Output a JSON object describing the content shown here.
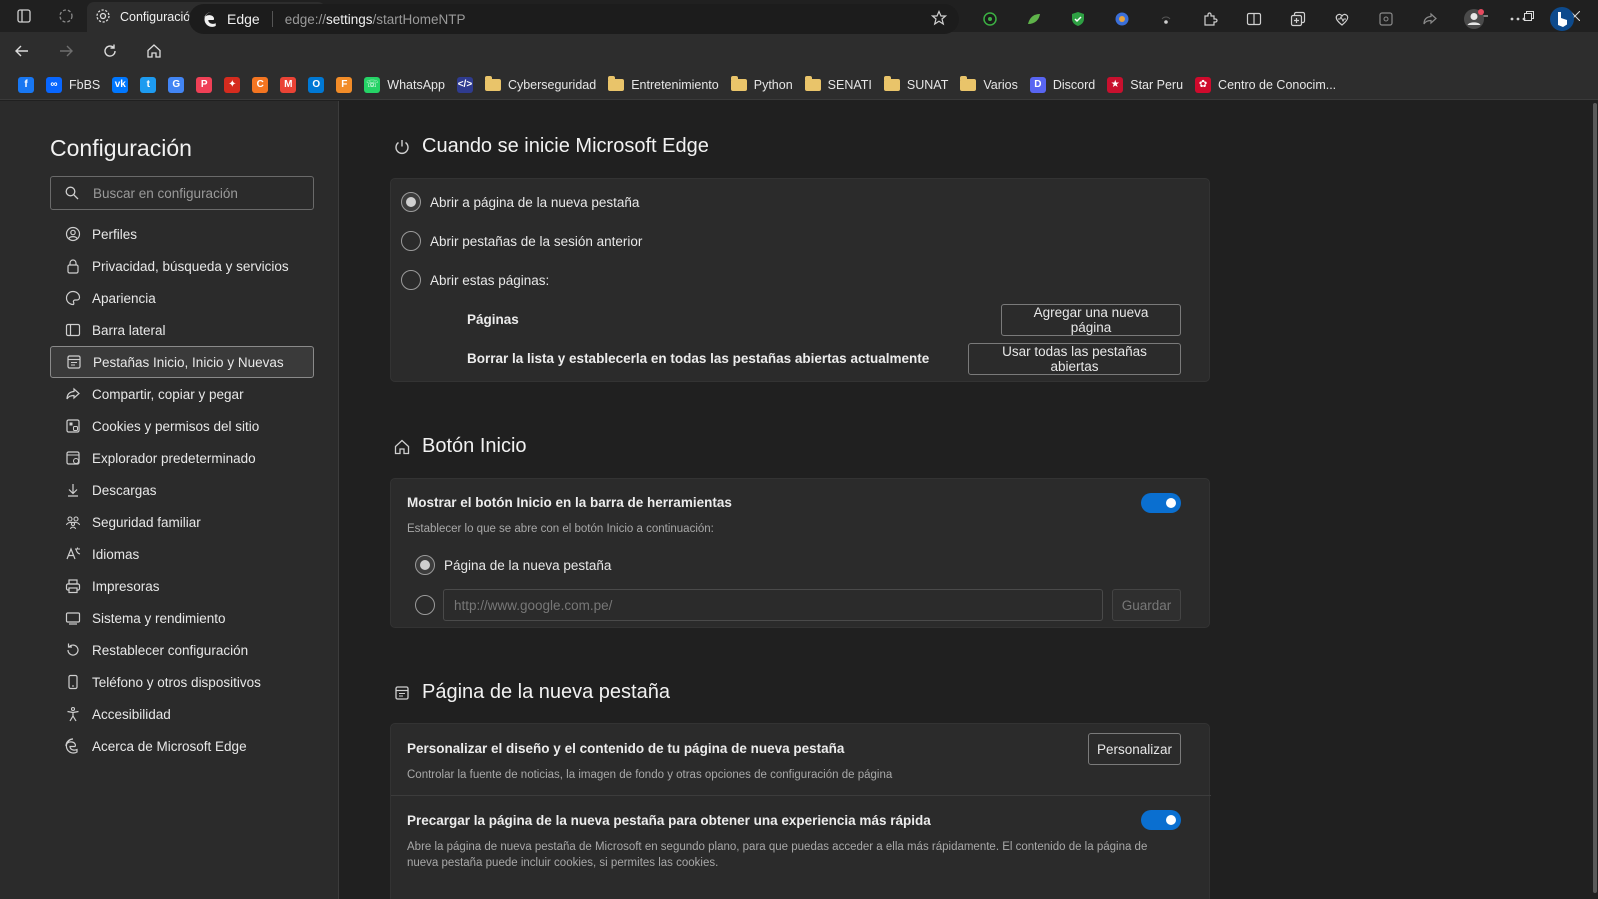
{
  "window": {
    "tab_title": "Configuración",
    "new_tab": "+"
  },
  "toolbar": {
    "brand": "Edge",
    "url_prefix": "edge://",
    "url_bold": "settings",
    "url_rest": "/startHomeNTP"
  },
  "favorites": [
    {
      "label": "",
      "icon": "facebook-icon",
      "color": "#1877f2",
      "glyph": "f"
    },
    {
      "label": "FbBS",
      "icon": "meta-icon",
      "color": "#0866ff",
      "glyph": "∞"
    },
    {
      "label": "",
      "icon": "vk-icon",
      "color": "#0077ff",
      "glyph": "vk"
    },
    {
      "label": "",
      "icon": "twitter-icon",
      "color": "#1d9bf0",
      "glyph": "t"
    },
    {
      "label": "",
      "icon": "translate-icon",
      "color": "#4285f4",
      "glyph": "G"
    },
    {
      "label": "",
      "icon": "pocket-icon",
      "color": "#ef4056",
      "glyph": "P"
    },
    {
      "label": "",
      "icon": "canada-icon",
      "color": "#d52b1e",
      "glyph": "✦"
    },
    {
      "label": "",
      "icon": "crunchyroll-icon",
      "color": "#f47521",
      "glyph": "C"
    },
    {
      "label": "",
      "icon": "gmail-icon",
      "color": "#ea4335",
      "glyph": "M"
    },
    {
      "label": "",
      "icon": "outlook-icon",
      "color": "#0078d4",
      "glyph": "O"
    },
    {
      "label": "",
      "icon": "fiverr-icon",
      "color": "#f28c28",
      "glyph": "F"
    },
    {
      "label": "WhatsApp",
      "icon": "whatsapp-icon",
      "color": "#25d366",
      "glyph": "☏"
    },
    {
      "label": "",
      "icon": "code-icon",
      "color": "#2f3b8f",
      "glyph": "</>"
    },
    {
      "label": "Cyberseguridad",
      "icon": "folder-icon"
    },
    {
      "label": "Entretenimiento",
      "icon": "folder-icon"
    },
    {
      "label": "Python",
      "icon": "folder-icon"
    },
    {
      "label": "SENATI",
      "icon": "folder-icon"
    },
    {
      "label": "SUNAT",
      "icon": "folder-icon"
    },
    {
      "label": "Varios",
      "icon": "folder-icon"
    },
    {
      "label": "Discord",
      "icon": "discord-icon",
      "color": "#5865f2",
      "glyph": "D"
    },
    {
      "label": "Star Peru",
      "icon": "starperu-icon",
      "color": "#c8102e",
      "glyph": "★"
    },
    {
      "label": "Centro de Conocim...",
      "icon": "huawei-icon",
      "color": "#cf0a2c",
      "glyph": "✿"
    }
  ],
  "sidebar": {
    "title": "Configuración",
    "search_placeholder": "Buscar en configuración",
    "items": [
      {
        "label": "Perfiles",
        "icon": "profile-icon"
      },
      {
        "label": "Privacidad, búsqueda y servicios",
        "icon": "lock-icon"
      },
      {
        "label": "Apariencia",
        "icon": "appearance-icon"
      },
      {
        "label": "Barra lateral",
        "icon": "sidebar-icon"
      },
      {
        "label": "Pestañas Inicio, Inicio y Nuevas",
        "icon": "start-tabs-icon",
        "active": true
      },
      {
        "label": "Compartir, copiar y pegar",
        "icon": "share-icon"
      },
      {
        "label": "Cookies y permisos del sitio",
        "icon": "cookies-icon"
      },
      {
        "label": "Explorador predeterminado",
        "icon": "default-browser-icon"
      },
      {
        "label": "Descargas",
        "icon": "download-icon"
      },
      {
        "label": "Seguridad familiar",
        "icon": "family-icon"
      },
      {
        "label": "Idiomas",
        "icon": "languages-icon"
      },
      {
        "label": "Impresoras",
        "icon": "printer-icon"
      },
      {
        "label": "Sistema y rendimiento",
        "icon": "system-icon"
      },
      {
        "label": "Restablecer configuración",
        "icon": "reset-icon"
      },
      {
        "label": "Teléfono y otros dispositivos",
        "icon": "phone-icon"
      },
      {
        "label": "Accesibilidad",
        "icon": "accessibility-icon"
      },
      {
        "label": "Acerca de Microsoft Edge",
        "icon": "edge-icon"
      }
    ]
  },
  "startup": {
    "title": "Cuando se inicie Microsoft Edge",
    "option_ntp": "Abrir a página de la nueva pestaña",
    "option_previous": "Abrir pestañas de la sesión anterior",
    "option_pages": "Abrir estas páginas:",
    "pages_label": "Páginas",
    "add_page_button": "Agregar una nueva página",
    "clear_label": "Borrar la lista y establecerla en todas las pestañas abiertas actualmente",
    "use_all_button": "Usar todas las pestañas abiertas",
    "selected": "ntp"
  },
  "home_button": {
    "title": "Botón Inicio",
    "show_label": "Mostrar el botón Inicio en la barra de herramientas",
    "show_enabled": true,
    "desc": "Establecer lo que se abre con el botón Inicio a continuación:",
    "option_ntp": "Página de la nueva pestaña",
    "url_placeholder": "http://www.google.com.pe/",
    "save_button": "Guardar"
  },
  "new_tab_page": {
    "title": "Página de la nueva pestaña",
    "customize_label": "Personalizar el diseño y el contenido de tu página de nueva pestaña",
    "customize_desc": "Controlar la fuente de noticias, la imagen de fondo y otras opciones de configuración de página",
    "customize_button": "Personalizar",
    "preload_label": "Precargar la página de la nueva pestaña para obtener una experiencia más rápida",
    "preload_enabled": true,
    "preload_desc": "Abre la página de nueva pestaña de Microsoft en segundo plano, para que puedas acceder a ella más rápidamente. El contenido de la página de nueva pestaña puede incluir cookies, si permites las cookies."
  }
}
